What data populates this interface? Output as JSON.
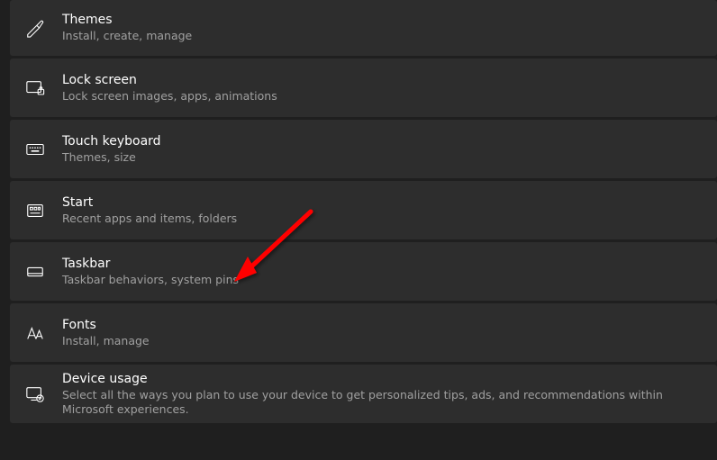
{
  "settings": {
    "items": [
      {
        "title": "Themes",
        "subtitle": "Install, create, manage"
      },
      {
        "title": "Lock screen",
        "subtitle": "Lock screen images, apps, animations"
      },
      {
        "title": "Touch keyboard",
        "subtitle": "Themes, size"
      },
      {
        "title": "Start",
        "subtitle": "Recent apps and items, folders"
      },
      {
        "title": "Taskbar",
        "subtitle": "Taskbar behaviors, system pins"
      },
      {
        "title": "Fonts",
        "subtitle": "Install, manage"
      },
      {
        "title": "Device usage",
        "subtitle": "Select all the ways you plan to use your device to get personalized tips, ads, and recommendations within Microsoft experiences."
      }
    ]
  },
  "annotation": {
    "arrow_color": "#ff0000",
    "arrow_target": "Taskbar"
  }
}
